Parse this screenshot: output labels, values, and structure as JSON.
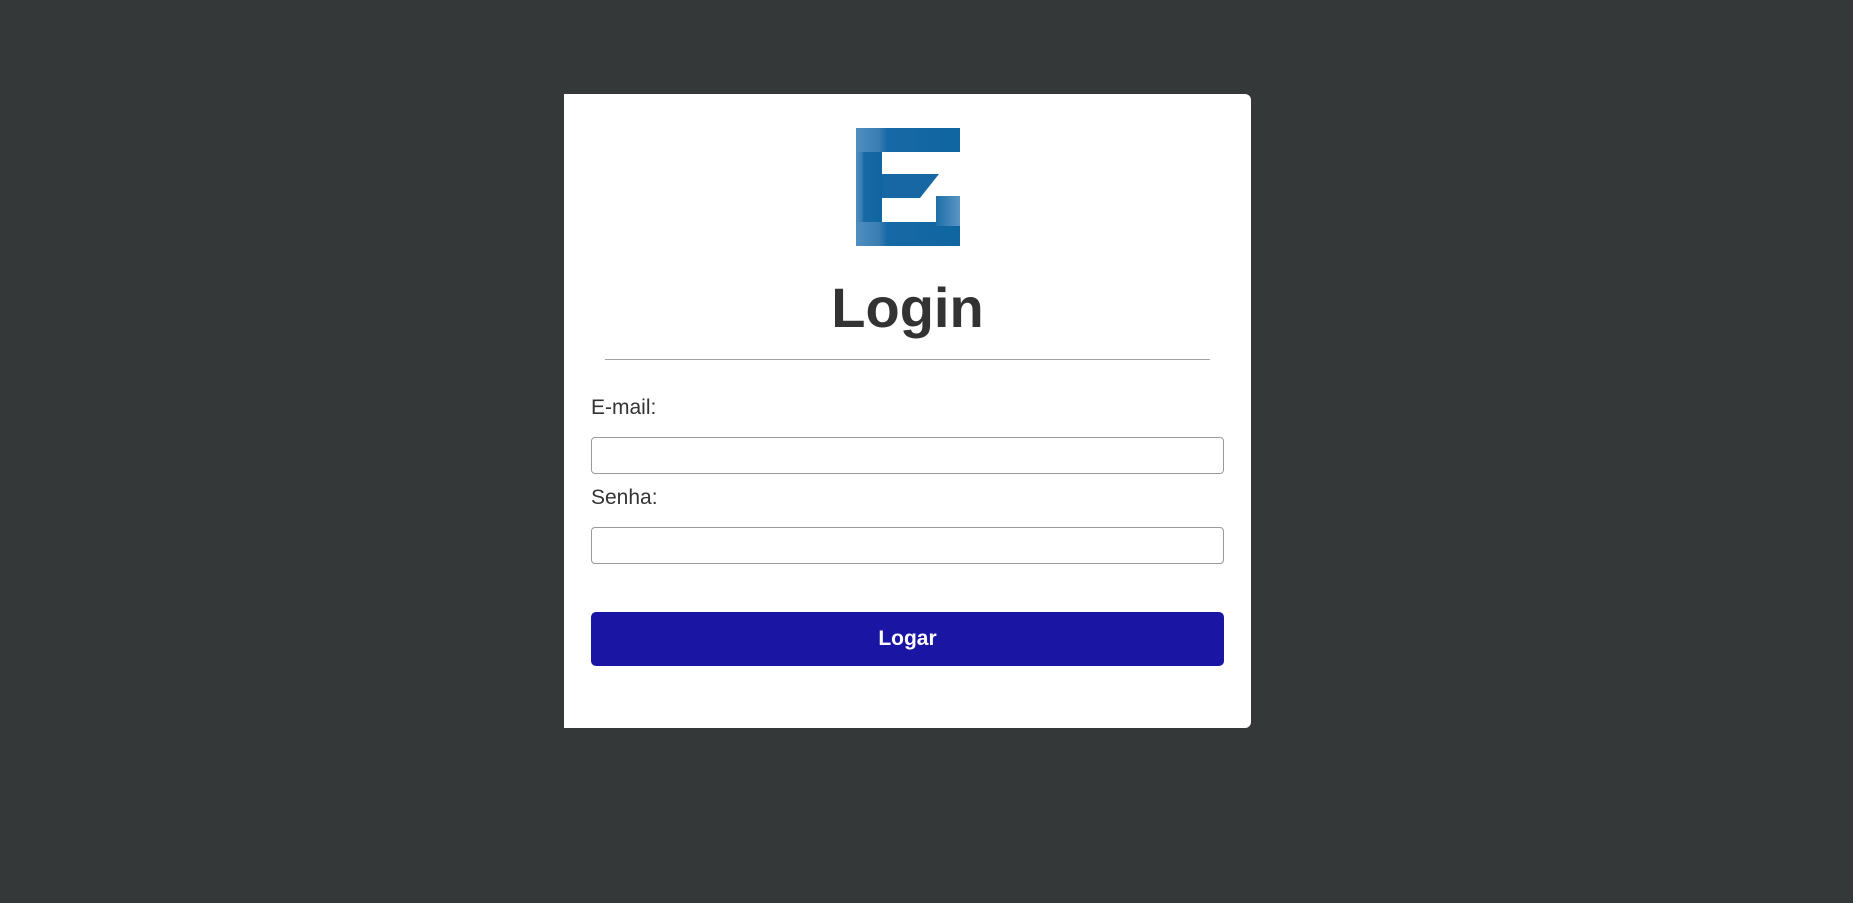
{
  "login": {
    "title": "Login",
    "email_label": "E-mail:",
    "email_value": "",
    "password_label": "Senha:",
    "password_value": "",
    "submit_label": "Logar"
  },
  "logo": {
    "icon": "e-logo-icon",
    "color_dark": "#0f65a0",
    "color_light": "#4d8fbf"
  },
  "colors": {
    "background": "#343839",
    "button": "#1a16a3"
  }
}
